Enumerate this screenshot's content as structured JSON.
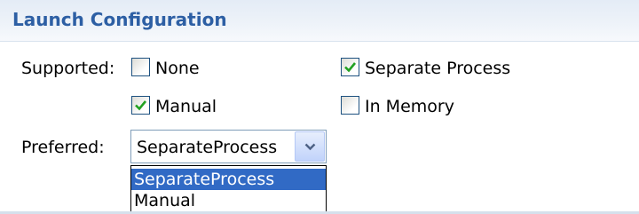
{
  "section": {
    "title": "Launch Configuration"
  },
  "supported": {
    "label": "Supported:",
    "options": [
      {
        "label": "None",
        "checked": false
      },
      {
        "label": "Separate Process",
        "checked": true
      },
      {
        "label": "Manual",
        "checked": true
      },
      {
        "label": "In Memory",
        "checked": false
      }
    ]
  },
  "preferred": {
    "label": "Preferred:",
    "selected": "SeparateProcess",
    "dropdown_options": [
      "SeparateProcess",
      "Manual"
    ],
    "highlighted_option": "SeparateProcess"
  },
  "colors": {
    "header_title": "#2d5fa4",
    "checkmark": "#21a121",
    "highlight": "#316ac5"
  },
  "icons": {
    "checkmark": "checkmark-icon",
    "dropdown_arrow": "chevron-down-icon"
  }
}
